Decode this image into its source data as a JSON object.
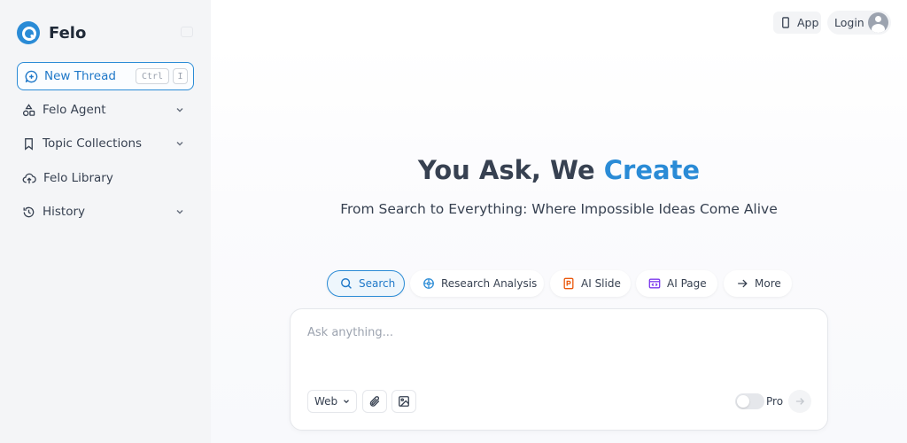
{
  "sidebar": {
    "brand": "Felo",
    "new_thread": {
      "label": "New Thread",
      "shortcut_mod": "Ctrl",
      "shortcut_key": "I"
    },
    "items": [
      {
        "label": "Felo Agent",
        "icon": "agent-shapes-icon",
        "expandable": true
      },
      {
        "label": "Topic Collections",
        "icon": "bookmark-icon",
        "expandable": true
      },
      {
        "label": "Felo Library",
        "icon": "cloud-upload-icon",
        "expandable": false
      },
      {
        "label": "History",
        "icon": "history-icon",
        "expandable": true
      }
    ]
  },
  "header": {
    "app_label": "App",
    "login_label": "Login"
  },
  "hero": {
    "title_prefix": "You Ask, We",
    "title_accent": "Create",
    "subtitle": "From Search to Everything: Where Impossible Ideas Come Alive"
  },
  "modes": [
    {
      "label": "Search",
      "icon": "search-icon",
      "active": true
    },
    {
      "label": "Research Analysis",
      "icon": "research-icon",
      "active": false
    },
    {
      "label": "AI Slide",
      "icon": "slide-icon",
      "active": false
    },
    {
      "label": "AI Page",
      "icon": "page-code-icon",
      "active": false
    },
    {
      "label": "More",
      "icon": "arrow-right-icon",
      "active": false
    }
  ],
  "ask": {
    "placeholder": "Ask anything...",
    "value": "",
    "source_select": "Web",
    "pro_label": "Pro",
    "pro_enabled": false
  },
  "colors": {
    "accent": "#2a8bd6",
    "sidebar_bg": "#f4f5f7"
  }
}
